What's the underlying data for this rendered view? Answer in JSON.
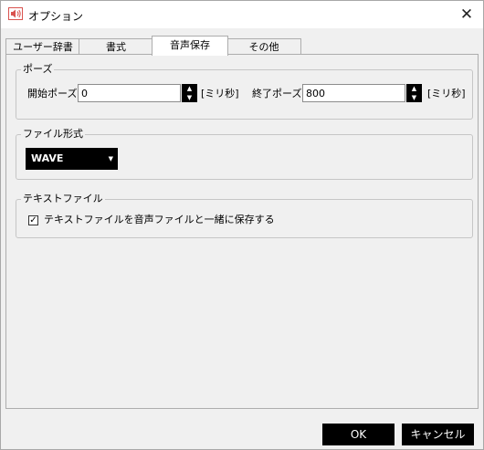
{
  "window": {
    "title": "オプション",
    "icon": "speaker-icon",
    "close_glyph": "✕"
  },
  "tabs": [
    {
      "label": "ユーザー辞書",
      "active": false
    },
    {
      "label": "書式",
      "active": false
    },
    {
      "label": "音声保存",
      "active": true
    },
    {
      "label": "その他",
      "active": false
    }
  ],
  "pause": {
    "legend": "ポーズ",
    "start_label": "開始ポーズ",
    "start_value": "0",
    "start_unit": "[ミリ秒]",
    "end_label": "終了ポーズ",
    "end_value": "800",
    "end_unit": "[ミリ秒]"
  },
  "file_format": {
    "legend": "ファイル形式",
    "selected": "WAVE"
  },
  "text_file": {
    "legend": "テキストファイル",
    "checkbox_label": "テキストファイルを音声ファイルと一緒に保存する",
    "checked": true
  },
  "buttons": {
    "ok": "OK",
    "cancel": "キャンセル"
  },
  "colors": {
    "accent": "#000000",
    "background": "#f0f0f0",
    "icon_red": "#d9534f"
  }
}
